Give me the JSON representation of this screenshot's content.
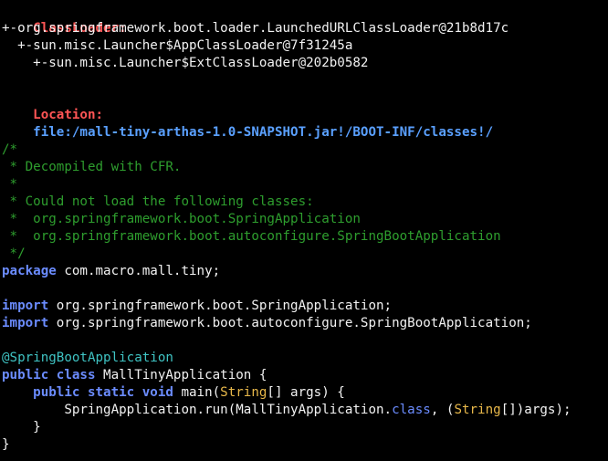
{
  "terminal": {
    "classloader_label": "ClassLoader:",
    "classloader_lines": [
      "+-org.springframework.boot.loader.LaunchedURLClassLoader@21b8d17c",
      "  +-sun.misc.Launcher$AppClassLoader@7f31245a",
      "    +-sun.misc.Launcher$ExtClassLoader@202b0582"
    ],
    "location_label": "Location:",
    "location_value": "file:/mall-tiny-arthas-1.0-SNAPSHOT.jar!/BOOT-INF/classes!/",
    "comment_lines": [
      "/*",
      " * Decompiled with CFR.",
      " *",
      " * Could not load the following classes:",
      " *  org.springframework.boot.SpringApplication",
      " *  org.springframework.boot.autoconfigure.SpringBootApplication",
      " */"
    ],
    "package_kw": "package",
    "package_name": " com.macro.mall.tiny;",
    "import_kw": "import",
    "import_1": " org.springframework.boot.SpringApplication;",
    "import_2": " org.springframework.boot.autoconfigure.SpringBootApplication;",
    "annotation": "@SpringBootApplication",
    "class_decl_kw": "public class",
    "class_decl_rest": " MallTinyApplication {",
    "main_indent": "    ",
    "main_kw": "public static void",
    "main_name": " main(",
    "main_type": "String",
    "main_rest": "[] args) {",
    "call_indent": "        ",
    "call_prefix": "SpringApplication.run(MallTinyApplication.",
    "call_class_kw": "class",
    "call_mid": ", (",
    "call_type": "String",
    "call_suffix": "[])args);",
    "close_inner": "    }",
    "close_outer": "}"
  }
}
